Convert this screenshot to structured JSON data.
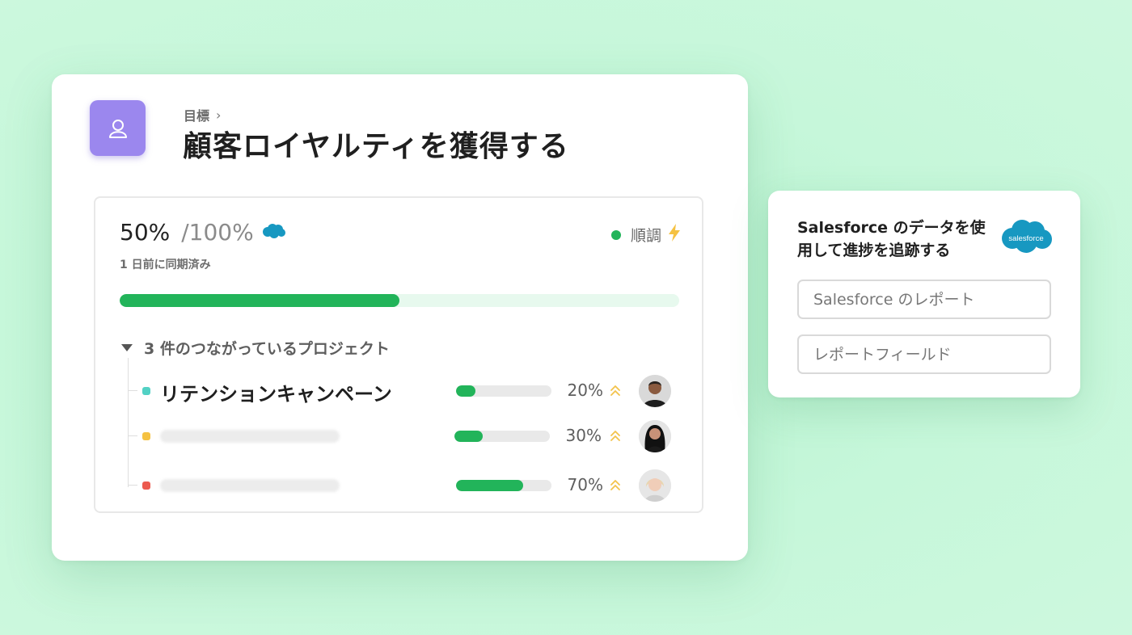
{
  "goal": {
    "breadcrumb": "目標",
    "title": "顧客ロイヤルティを獲得する",
    "icon": "goal-person-icon",
    "accent_color": "#9b87ee"
  },
  "progress": {
    "current": "50%",
    "target": "/100%",
    "value": 0.5,
    "source_icon": "salesforce-cloud-icon",
    "sync_text": "1 日前に同期済み",
    "status_label": "順調",
    "status_color": "#22b45a"
  },
  "projects": {
    "toggle_label": "3 件のつながっているプロジェクト",
    "items": [
      {
        "name": "リテンションキャンペーン",
        "percent": "20%",
        "value": 0.2,
        "dot_color": "#52d1c4",
        "avatar": "avatar-man"
      },
      {
        "name": "",
        "percent": "30%",
        "value": 0.3,
        "dot_color": "#f5c242",
        "avatar": "avatar-woman-dark-hair"
      },
      {
        "name": "",
        "percent": "70%",
        "value": 0.7,
        "dot_color": "#ec5a4f",
        "avatar": "avatar-woman-blonde"
      }
    ]
  },
  "salesforce_card": {
    "description": "Salesforce のデータを使用して進捗を追跡する",
    "logo_text": "salesforce",
    "report_placeholder": "Salesforce のレポート",
    "field_placeholder": "レポートフィールド"
  }
}
